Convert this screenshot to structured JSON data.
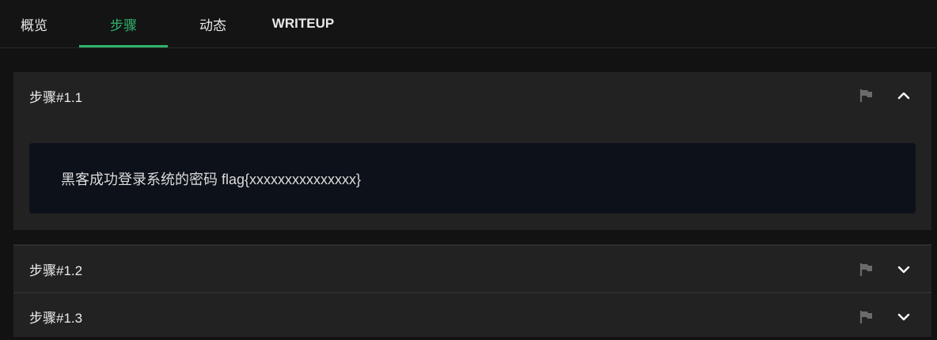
{
  "tabs": [
    {
      "label": "概览",
      "active": false
    },
    {
      "label": "步骤",
      "active": true
    },
    {
      "label": "动态",
      "active": false
    },
    {
      "label": "WRITEUP",
      "active": false
    }
  ],
  "steps": [
    {
      "title": "步骤#1.1",
      "expanded": true,
      "content": "黑客成功登录系统的密码 flag{xxxxxxxxxxxxxxx}",
      "toggle_icon": "chevron-up-icon"
    },
    {
      "title": "步骤#1.2",
      "expanded": false,
      "toggle_icon": "chevron-down-icon"
    },
    {
      "title": "步骤#1.3",
      "expanded": false,
      "toggle_icon": "chevron-down-icon"
    }
  ],
  "colors": {
    "accent": "#2fb36b",
    "panel": "#222222",
    "content_bg": "#0d111a",
    "icon_muted": "#6b6b6b"
  }
}
